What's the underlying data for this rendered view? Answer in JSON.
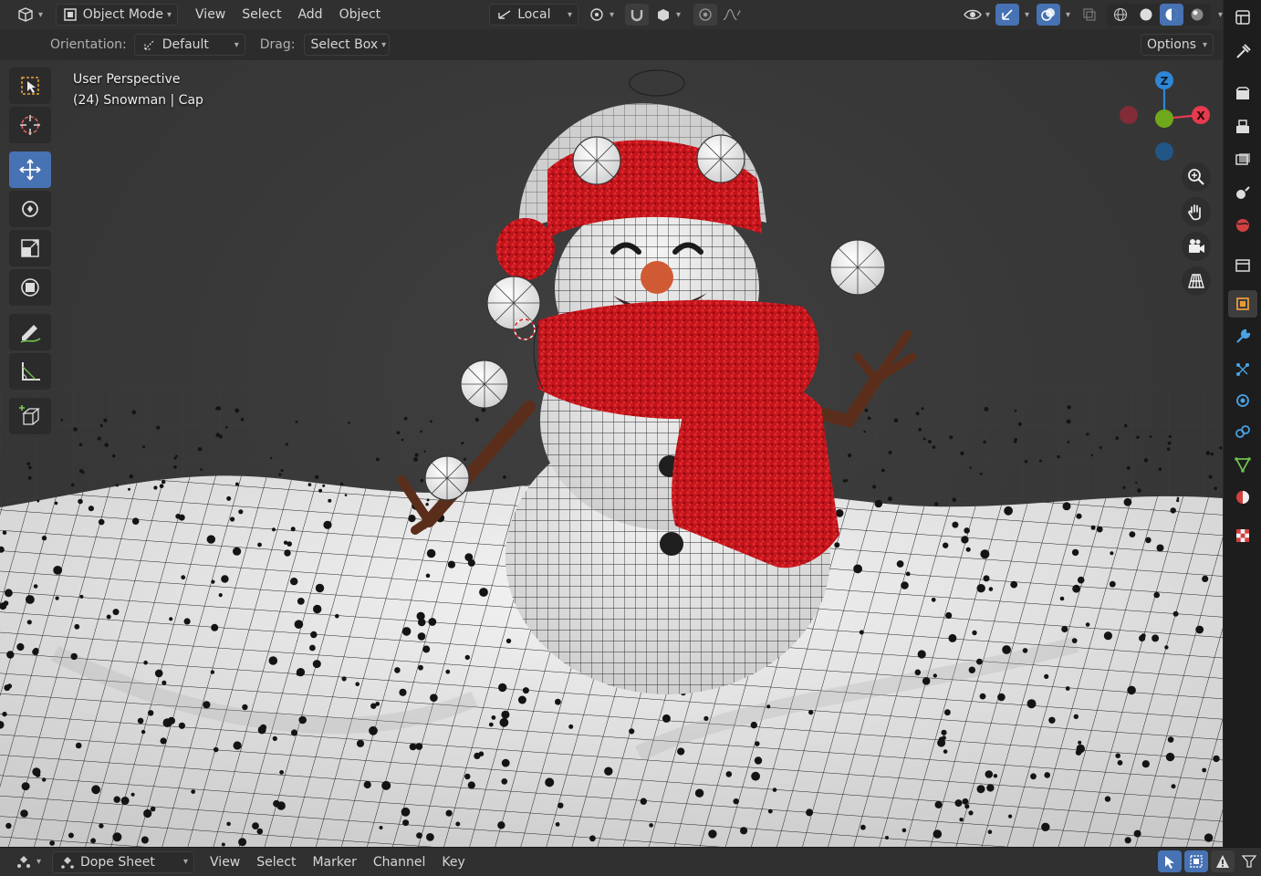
{
  "header": {
    "editor_type_icon": "editor-type-3d-viewport-icon",
    "mode": "Object Mode",
    "menus": [
      "View",
      "Select",
      "Add",
      "Object"
    ],
    "transform_orientation": "Local",
    "options_label": "Options"
  },
  "tool_settings": {
    "orientation_label": "Orientation:",
    "orientation_value": "Default",
    "drag_label": "Drag:",
    "drag_value": "Select Box"
  },
  "viewport": {
    "perspective_label": "User Perspective",
    "object_label": "(24) Snowman | Cap",
    "gizmo_axes": [
      "Z",
      "X"
    ]
  },
  "toolbar": {
    "tools": [
      "select-box",
      "cursor",
      "move",
      "rotate",
      "scale",
      "transform",
      "annotate",
      "measure",
      "add-cube"
    ],
    "active_tool": "move"
  },
  "properties_tabs": [
    "tool",
    "render",
    "output",
    "view-layer",
    "scene",
    "world",
    "collection",
    "object",
    "modifiers",
    "particles",
    "physics",
    "constraints",
    "data",
    "material",
    "texture"
  ],
  "bottom_editor": {
    "editor_type": "Dope Sheet",
    "menus": [
      "View",
      "Select",
      "Marker",
      "Channel",
      "Key"
    ]
  },
  "colors": {
    "accent": "#4772b3",
    "axis_x": "#e63a4e",
    "axis_y": "#6fa81a",
    "axis_z": "#2f86d6",
    "scarf_red": "#c8141c"
  }
}
